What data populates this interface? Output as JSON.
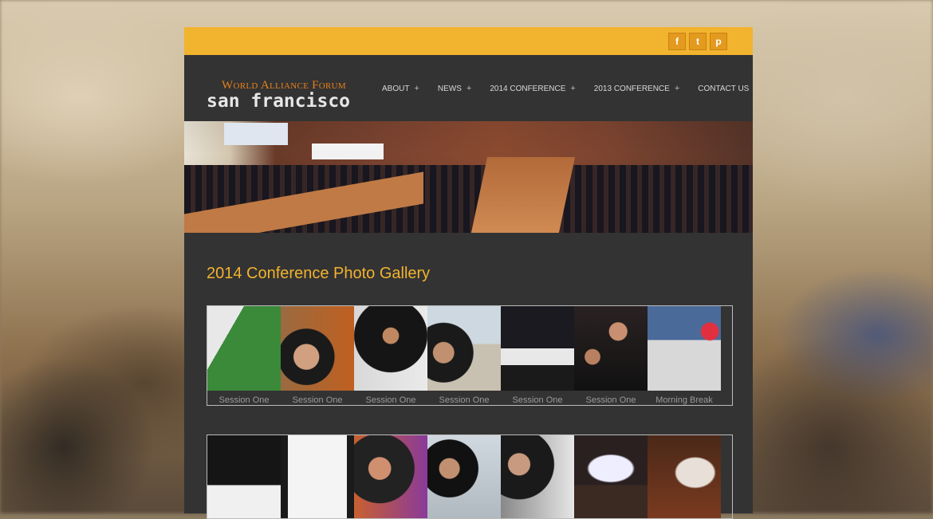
{
  "social": [
    "f",
    "t",
    "p"
  ],
  "logo": {
    "top": "World Alliance Forum",
    "main": "san francisco"
  },
  "nav": [
    {
      "label": "About",
      "plus": "+"
    },
    {
      "label": "News",
      "plus": "+"
    },
    {
      "label": "2014 Conference",
      "plus": "+"
    },
    {
      "label": "2013 Conference",
      "plus": "+"
    },
    {
      "label": "Contact Us",
      "plus": ""
    }
  ],
  "gallery_title": "2014 Conference Photo Gallery",
  "row1": [
    {
      "caption": "Session One",
      "bg": "#3a7a3a"
    },
    {
      "caption": "Session One",
      "bg": "#7a5030"
    },
    {
      "caption": "Session One",
      "bg": "#2a2a2a"
    },
    {
      "caption": "Session One",
      "bg": "#c8c8c8"
    },
    {
      "caption": "Session One",
      "bg": "#1e1e22"
    },
    {
      "caption": "Session One",
      "bg": "#2a2020"
    },
    {
      "caption": "Morning Break",
      "bg": "#2a3040"
    }
  ],
  "row2": [
    {
      "bg": "#1a1a1a"
    },
    {
      "bg": "#e8e8e8"
    },
    {
      "bg": "#8a4a8a"
    },
    {
      "bg": "#c8ccd0"
    },
    {
      "bg": "#b0b0b0"
    },
    {
      "bg": "#3a2a25"
    },
    {
      "bg": "#5a3020"
    }
  ],
  "colors": {
    "accent": "#f2b32e",
    "logo_orange": "#e8801c",
    "panel": "#333333"
  }
}
